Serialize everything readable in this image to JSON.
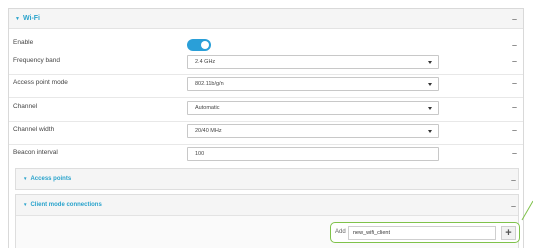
{
  "section": {
    "title": "Wi-Fi"
  },
  "fields": {
    "enable": {
      "label": "Enable",
      "on": true
    },
    "frequency_band": {
      "label": "Frequency band",
      "value": "2.4 GHz"
    },
    "access_point_mode": {
      "label": "Access point mode",
      "value": "802.11b/g/n"
    },
    "channel": {
      "label": "Channel",
      "value": "Automatic"
    },
    "channel_width": {
      "label": "Channel width",
      "value": "20/40 MHz"
    },
    "beacon_interval": {
      "label": "Beacon interval",
      "value": "100"
    }
  },
  "subsections": {
    "access_points": {
      "title": "Access points"
    },
    "client_mode": {
      "title": "Client mode connections"
    }
  },
  "add": {
    "label": "Add",
    "input_value": "new_wifi_client"
  },
  "colors": {
    "accent": "#29a3cc",
    "toggle": "#2a9fd8",
    "highlight": "#7fc24a"
  },
  "icons": {
    "remove": "minus-icon",
    "add": "plus-icon",
    "expand": "caret-down-icon"
  }
}
